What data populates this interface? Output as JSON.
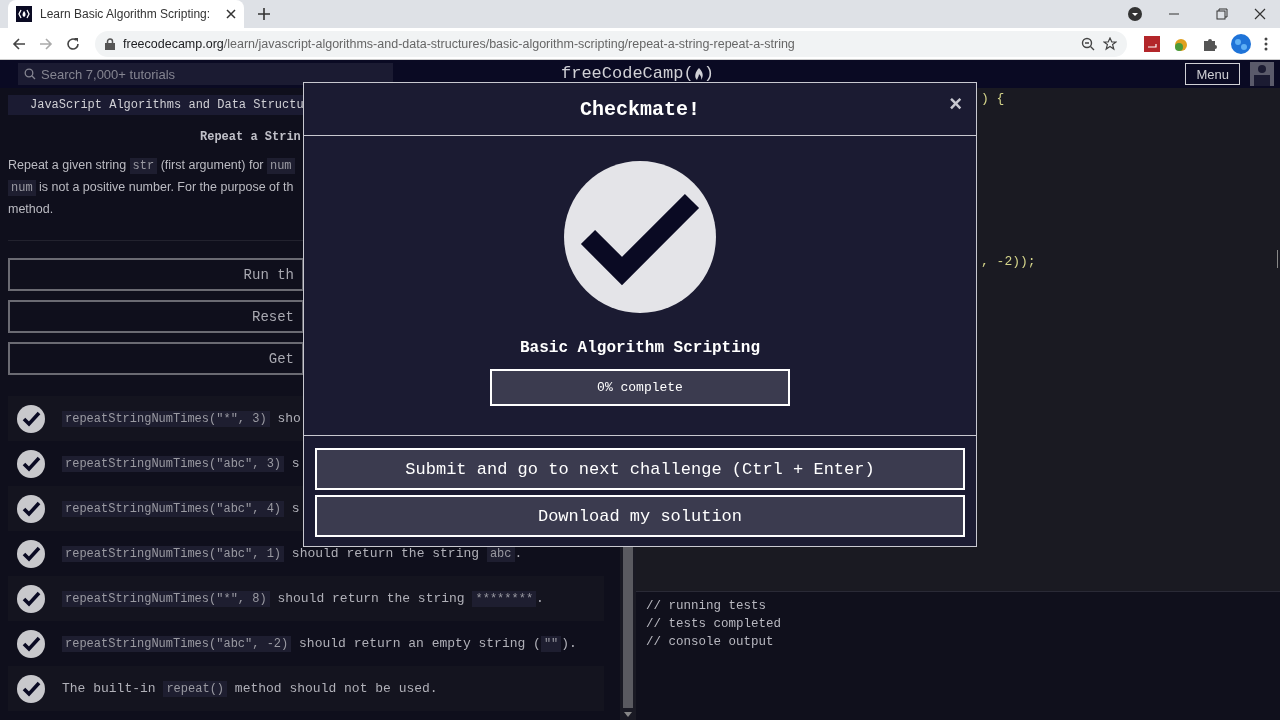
{
  "browser": {
    "tab_title": "Learn Basic Algorithm Scripting:",
    "url_domain": "freecodecamp.org",
    "url_path": "/learn/javascript-algorithms-and-data-structures/basic-algorithm-scripting/repeat-a-string-repeat-a-string"
  },
  "nav": {
    "search_placeholder": "Search 7,000+ tutorials",
    "logo": "freeCodeCamp(",
    "logo_end": ")",
    "menu": "Menu"
  },
  "lesson": {
    "breadcrumb": "JavaScript Algorithms and Data Structu",
    "title": "Repeat a Strin",
    "description": [
      [
        {
          "text": "Repeat a given string ",
          "kind": "text"
        },
        {
          "text": "str",
          "kind": "code"
        },
        {
          "text": " (first argument) for ",
          "kind": "text"
        },
        {
          "text": "num",
          "kind": "code"
        }
      ],
      [
        {
          "text": "num",
          "kind": "code"
        },
        {
          "text": " is not a positive number. For the purpose of th",
          "kind": "text"
        }
      ],
      [
        {
          "text": "method.",
          "kind": "text"
        }
      ]
    ],
    "buttons": [
      "Run th",
      "Reset",
      "Get"
    ],
    "tests": [
      {
        "passed": true,
        "parts": [
          {
            "text": "repeatStringNumTimes(\"*\", 3)",
            "kind": "code"
          },
          {
            "text": " sho",
            "kind": "text"
          }
        ]
      },
      {
        "passed": true,
        "parts": [
          {
            "text": "repeatStringNumTimes(\"abc\", 3)",
            "kind": "code"
          },
          {
            "text": " s",
            "kind": "text"
          }
        ]
      },
      {
        "passed": true,
        "parts": [
          {
            "text": "repeatStringNumTimes(\"abc\", 4)",
            "kind": "code"
          },
          {
            "text": " s",
            "kind": "text"
          }
        ]
      },
      {
        "passed": true,
        "parts": [
          {
            "text": "repeatStringNumTimes(\"abc\", 1)",
            "kind": "code"
          },
          {
            "text": " should return the string ",
            "kind": "text"
          },
          {
            "text": "abc",
            "kind": "code"
          },
          {
            "text": ".",
            "kind": "text"
          }
        ]
      },
      {
        "passed": true,
        "parts": [
          {
            "text": "repeatStringNumTimes(\"*\", 8)",
            "kind": "code"
          },
          {
            "text": " should return the string ",
            "kind": "text"
          },
          {
            "text": "********",
            "kind": "code"
          },
          {
            "text": ".",
            "kind": "text"
          }
        ]
      },
      {
        "passed": true,
        "parts": [
          {
            "text": "repeatStringNumTimes(\"abc\", -2)",
            "kind": "code"
          },
          {
            "text": " should return an empty string (",
            "kind": "text"
          },
          {
            "text": "\"\"",
            "kind": "code"
          },
          {
            "text": ").",
            "kind": "text"
          }
        ]
      },
      {
        "passed": true,
        "parts": [
          {
            "text": "The built-in ",
            "kind": "text"
          },
          {
            "text": "repeat()",
            "kind": "code"
          },
          {
            "text": " method should not be used.",
            "kind": "text"
          }
        ]
      }
    ]
  },
  "editor": {
    "lines": [
      ") {",
      ", -2));"
    ]
  },
  "console": [
    "// running tests",
    "// tests completed",
    "// console output"
  ],
  "modal": {
    "title": "Checkmate!",
    "close": "×",
    "block": "Basic Algorithm Scripting",
    "progress": {
      "level": 0,
      "label": "0% complete"
    },
    "buttons": [
      "Submit and go to next challenge (Ctrl + Enter)",
      "Download my solution"
    ]
  }
}
